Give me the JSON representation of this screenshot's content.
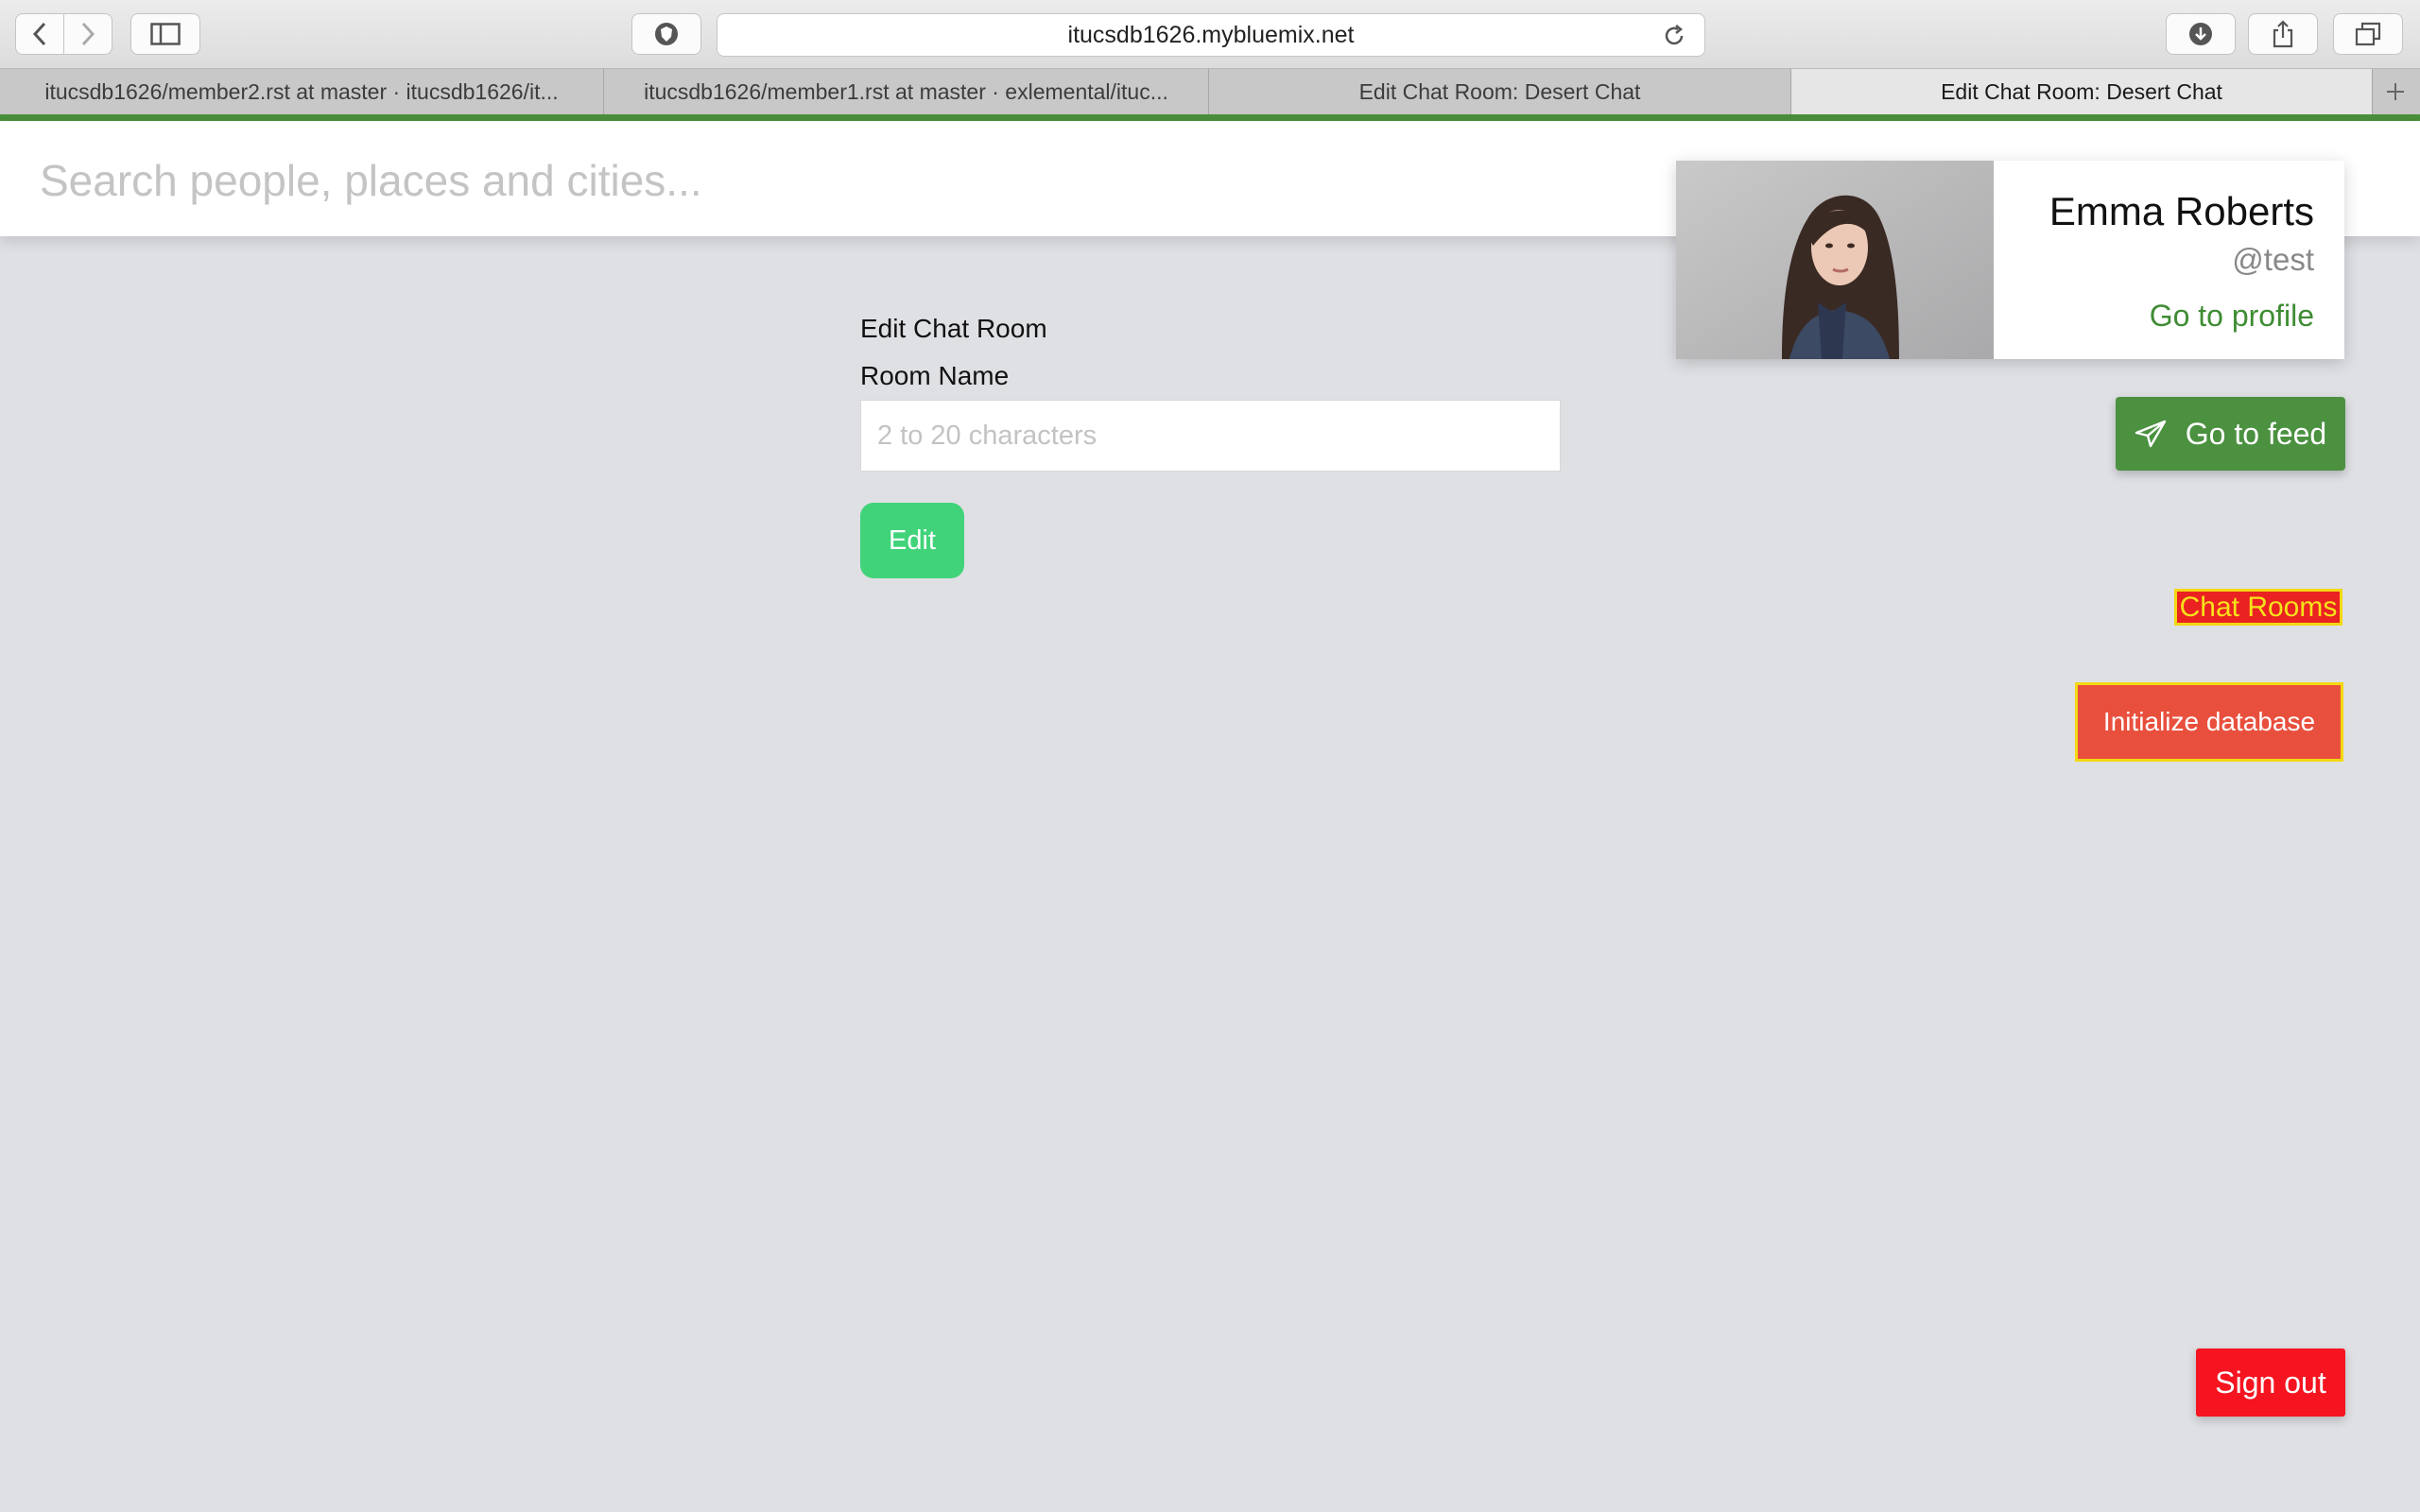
{
  "browser": {
    "url": "itucsdb1626.mybluemix.net",
    "tabs": [
      {
        "title": "itucsdb1626/member2.rst at master · itucsdb1626/it..."
      },
      {
        "title": "itucsdb1626/member1.rst at master · exlemental/ituc..."
      },
      {
        "title": "Edit Chat Room: Desert Chat"
      },
      {
        "title": "Edit Chat Room: Desert Chat",
        "active": true
      }
    ],
    "accent_color": "#4a8f3c"
  },
  "search": {
    "placeholder": "Search people, places and cities..."
  },
  "profile": {
    "name": "Emma Roberts",
    "handle": "@test",
    "link_label": "Go to profile"
  },
  "sidebar": {
    "feed_button": "Go to feed",
    "chat_rooms_link": "Chat Rooms",
    "init_db_button": "Initialize database",
    "signout_button": "Sign out"
  },
  "form": {
    "title": "Edit Chat Room",
    "room_name_label": "Room Name",
    "room_name_placeholder": "2 to 20 characters",
    "room_name_value": "",
    "submit_label": "Edit"
  },
  "colors": {
    "page_bg": "#dfe0e4",
    "green_button": "#4b9140",
    "edit_button": "#41d37a",
    "init_button": "#e8503d",
    "signout_button": "#f5141f",
    "highlight_border": "#f4d813"
  }
}
